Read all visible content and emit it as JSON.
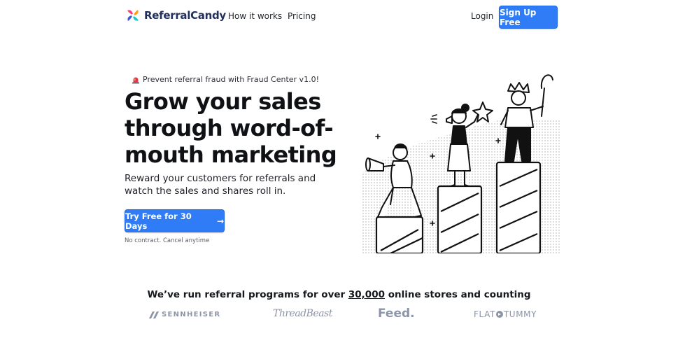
{
  "nav": {
    "logo_text": "ReferralCandy",
    "links": [
      {
        "label": "How it works"
      },
      {
        "label": "Pricing"
      }
    ],
    "login_label": "Login",
    "signup_label": "Sign Up Free"
  },
  "hero": {
    "badge_text": "Prevent referral fraud with Fraud Center v1.0!",
    "headline": "Grow your sales through word-of-mouth marketing",
    "subhead": "Reward your customers for referrals and watch the sales and shares roll in.",
    "cta_label": "Try Free for 30 Days",
    "cta_arrow": "→",
    "fineprint": "No contract. Cancel anytime"
  },
  "proof": {
    "text_before": "We’ve run referral programs for over ",
    "highlight": "30,000",
    "text_after": " online stores and counting"
  },
  "brands": {
    "sennheiser": "SENNHEISER",
    "threadbeast": "ThreadBeast",
    "feed": "Feed.",
    "flattummy_a": "FLAT",
    "flattummy_b": "TUMMY"
  },
  "colors": {
    "primary": "#2f7cf6",
    "logo_text": "#22305b",
    "brand_gray": "#8c94a7"
  }
}
